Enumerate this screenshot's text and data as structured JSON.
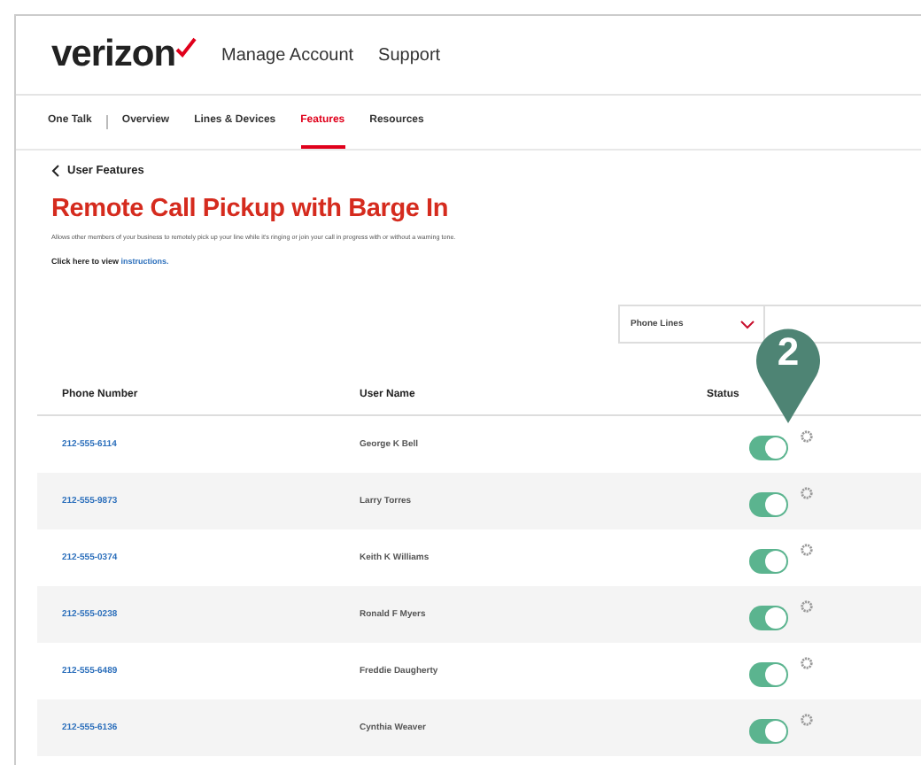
{
  "header": {
    "logo": "verizon",
    "links": [
      "Manage Account",
      "Support"
    ]
  },
  "tabs": [
    {
      "label": "One Talk",
      "selected": false
    },
    {
      "label": "Overview",
      "selected": false
    },
    {
      "label": "Lines & Devices",
      "selected": false
    },
    {
      "label": "Features",
      "selected": true
    },
    {
      "label": "Resources",
      "selected": false
    }
  ],
  "back_link": "User Features",
  "title": "Remote Call Pickup with Barge In",
  "description": "Allows other members of your business to remotely pick up your line while it's ringing or join your call in progress with or without a warning tone.",
  "instructions": {
    "text": "Click here to view",
    "link": "instructions."
  },
  "filter": {
    "value": "Phone Lines"
  },
  "callout": "2",
  "table": {
    "columns": [
      "Phone Number",
      "User Name",
      "Status"
    ],
    "rows": [
      {
        "phone": "212-555-6114",
        "name": "George K Bell",
        "on": true
      },
      {
        "phone": "212-555-9873",
        "name": "Larry Torres",
        "on": true
      },
      {
        "phone": "212-555-0374",
        "name": "Keith K Williams",
        "on": true
      },
      {
        "phone": "212-555-0238",
        "name": "Ronald F Myers",
        "on": true
      },
      {
        "phone": "212-555-6489",
        "name": "Freddie Daugherty",
        "on": true
      },
      {
        "phone": "212-555-6136",
        "name": "Cynthia Weaver",
        "on": true
      }
    ]
  }
}
